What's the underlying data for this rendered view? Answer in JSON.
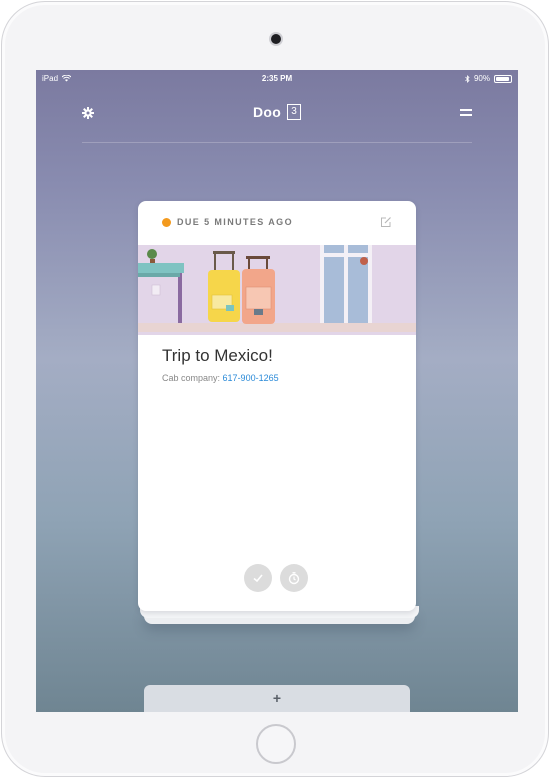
{
  "statusbar": {
    "device_name": "iPad",
    "time": "2:35 PM",
    "battery": "90%",
    "battery_level": 0.9
  },
  "header": {
    "title": "Doo",
    "count": "3",
    "settings_icon": "gear-icon",
    "menu_icon": "menu-icon"
  },
  "card": {
    "status_color": "#f39a1e",
    "due_label": "DUE 5 MINUTES AGO",
    "title": "Trip to Mexico!",
    "note_prefix": "Cab company:",
    "note_link": "617-900-1265",
    "edit_icon": "edit-icon",
    "actions": [
      {
        "icon": "checkmark-icon"
      },
      {
        "icon": "snooze-timer-icon"
      }
    ]
  },
  "add_bar": {
    "label": "+"
  },
  "colors": {
    "accent_link": "#2a8ad8",
    "status_overdue": "#f39a1e"
  }
}
